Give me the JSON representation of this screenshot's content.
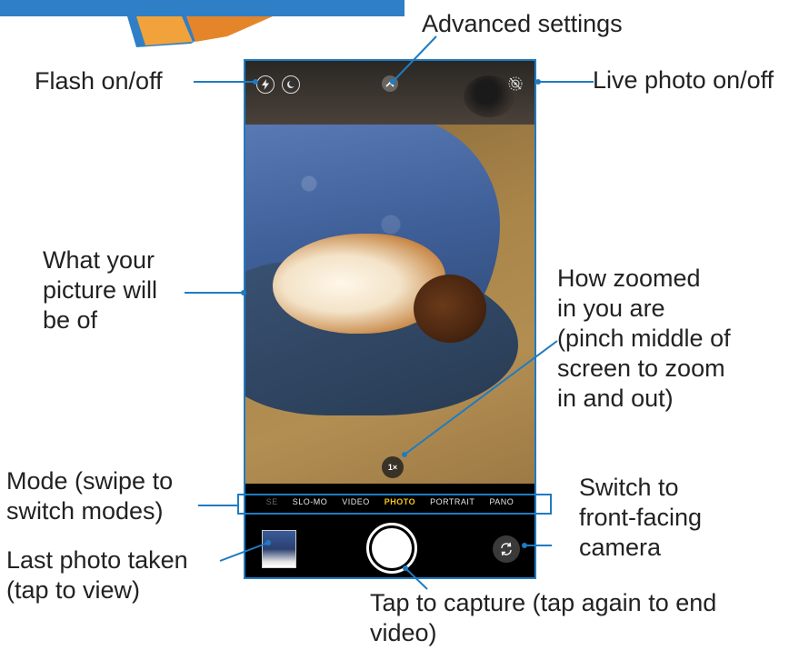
{
  "annotations": {
    "advanced_settings": "Advanced settings",
    "flash": "Flash on/off",
    "live_photo": "Live photo on/off",
    "preview": [
      "What your",
      "picture will",
      "be of"
    ],
    "zoom": [
      "How zoomed",
      "in you are",
      "(pinch middle of",
      "screen to zoom",
      "in and out)"
    ],
    "mode": [
      "Mode (swipe to",
      "switch modes)"
    ],
    "switch_camera": [
      "Switch to",
      "front-facing",
      "camera"
    ],
    "last_photo": [
      "Last photo taken",
      "(tap to view)"
    ],
    "capture": [
      "Tap to capture (tap again to end",
      "video)"
    ]
  },
  "camera": {
    "zoom_level": "1×",
    "modes": [
      "SE",
      "SLO-MO",
      "VIDEO",
      "PHOTO",
      "PORTRAIT",
      "PANO"
    ],
    "active_mode": "PHOTO"
  },
  "icons": {
    "flash": "flash-icon",
    "night": "night-mode-icon",
    "advanced": "chevron-up-icon",
    "live": "live-photo-off-icon",
    "flip": "camera-flip-icon"
  },
  "colors": {
    "annotation_blue": "#1f7bc2",
    "active_mode": "#f5c518"
  }
}
